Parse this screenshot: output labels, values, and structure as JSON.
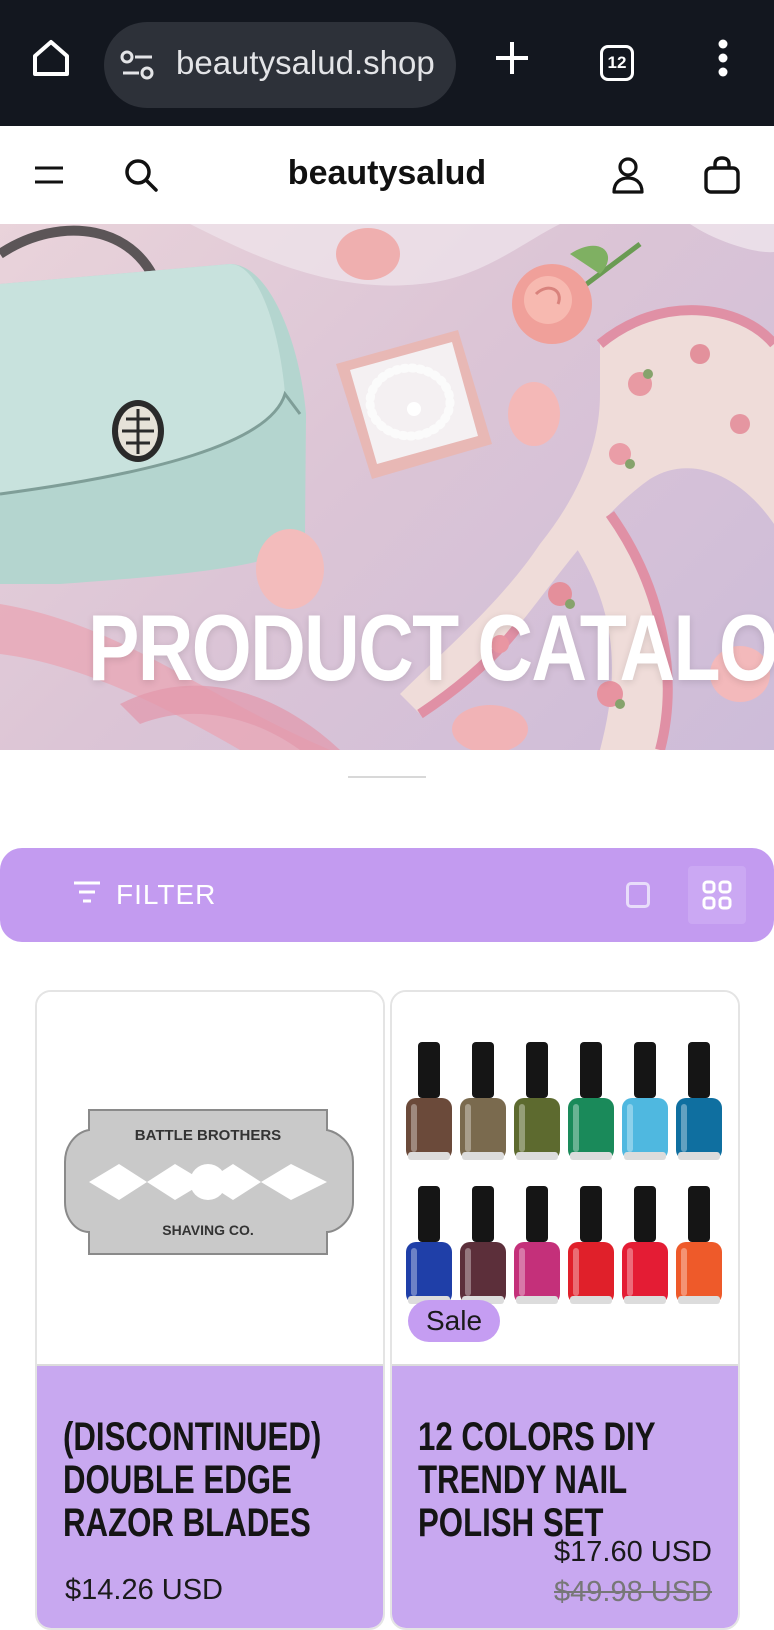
{
  "browser": {
    "url": "beautysalud.shop",
    "tab_count": "12",
    "icons": [
      "home-icon",
      "site-settings-icon",
      "new-tab-icon",
      "tab-switcher-icon",
      "more-options-icon"
    ]
  },
  "header": {
    "brand": "beautysalud",
    "icons": [
      "menu-icon",
      "search-icon",
      "account-icon",
      "cart-icon"
    ]
  },
  "hero": {
    "title": "PRODUCT CATALOG"
  },
  "toolbar": {
    "filter_label": "FILTER",
    "view_options": [
      "single-column",
      "grid"
    ],
    "active_view": "grid"
  },
  "products": [
    {
      "title": "(DISCONTINUED) DOUBLE EDGE RAZOR BLADES",
      "price": "$14.26 USD",
      "image_text_top": "BATTLE BROTHERS",
      "image_text_bottom": "SHAVING CO."
    },
    {
      "title": "12 COLORS DIY TRENDY NAIL POLISH SET",
      "price": "$17.60 USD",
      "compare_price": "$49.98 USD",
      "badge": "Sale"
    }
  ],
  "colors": {
    "accent": "#c39bf0",
    "card_info_bg": "#c8a8f0",
    "browser_bg": "#13171f"
  }
}
